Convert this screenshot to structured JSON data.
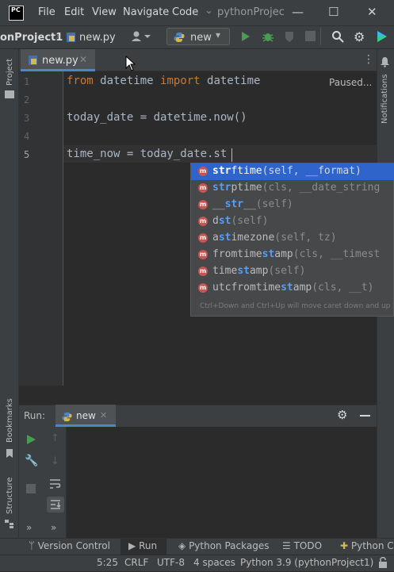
{
  "titlebar": {
    "logo_text": "PC",
    "menus": [
      "File",
      "Edit",
      "View",
      "Navigate",
      "Code"
    ],
    "separator": "⌄",
    "project_title": "pythonProjec",
    "window_controls": {
      "minimize": "—",
      "maximize": "☐",
      "close": "✕"
    }
  },
  "navbar": {
    "breadcrumb_project": "onProject1",
    "breadcrumb_file": "new.py",
    "run_config": "new"
  },
  "leftstrip": {
    "project_label": "Project",
    "bookmarks_label": "Bookmarks",
    "structure_label": "Structure"
  },
  "rightstrip": {
    "notifications_label": "Notifications"
  },
  "editor": {
    "tab_label": "new.py",
    "status": "Paused...",
    "line_numbers": [
      "1",
      "2",
      "3",
      "4",
      "5"
    ],
    "lines": [
      {
        "kw1": "from",
        "mid": " datetime ",
        "kw2": "import",
        "rest": " datetime"
      },
      "",
      "today_date = datetime.now()",
      "",
      "time_now = today_date.st"
    ]
  },
  "completion": {
    "items": [
      {
        "pre": "",
        "hl": "str",
        "name_rest": "ftime",
        "sig": "(self, __format)"
      },
      {
        "pre": "",
        "hl": "str",
        "name_rest": "ptime",
        "sig": "(cls, __date_string"
      },
      {
        "pre": "__",
        "hl": "str",
        "name_rest": "__",
        "sig": "(self)"
      },
      {
        "pre": "d",
        "hl": "st",
        "name_rest": "",
        "sig": "(self)"
      },
      {
        "pre": "a",
        "hl": "st",
        "name_rest": "imezone",
        "sig": "(self, tz)"
      },
      {
        "pre": "fromtime",
        "hl": "st",
        "name_rest": "amp",
        "sig": "(cls, __timest"
      },
      {
        "pre": "time",
        "hl": "st",
        "name_rest": "amp",
        "sig": "(self)"
      },
      {
        "pre": "utcfromtime",
        "hl": "st",
        "name_rest": "amp",
        "sig": "(cls, __t)"
      }
    ],
    "icon_letter": "m",
    "hint": "Ctrl+Down and Ctrl+Up will move caret down and up"
  },
  "run_panel": {
    "title": "Run:",
    "tab_label": "new"
  },
  "tool_windows": [
    "Version Control",
    "Run",
    "Python Packages",
    "TODO",
    "Python Co"
  ],
  "status_bar": {
    "position": "5:25",
    "line_sep": "CRLF",
    "encoding": "UTF-8",
    "indent": "4 spaces",
    "interpreter": "Python 3.9 (pythonProject1)"
  },
  "colors": {
    "accent": "#4a88c7",
    "selection": "#2f65ca",
    "keyword": "#cc7832",
    "method_icon": "#c75450"
  }
}
